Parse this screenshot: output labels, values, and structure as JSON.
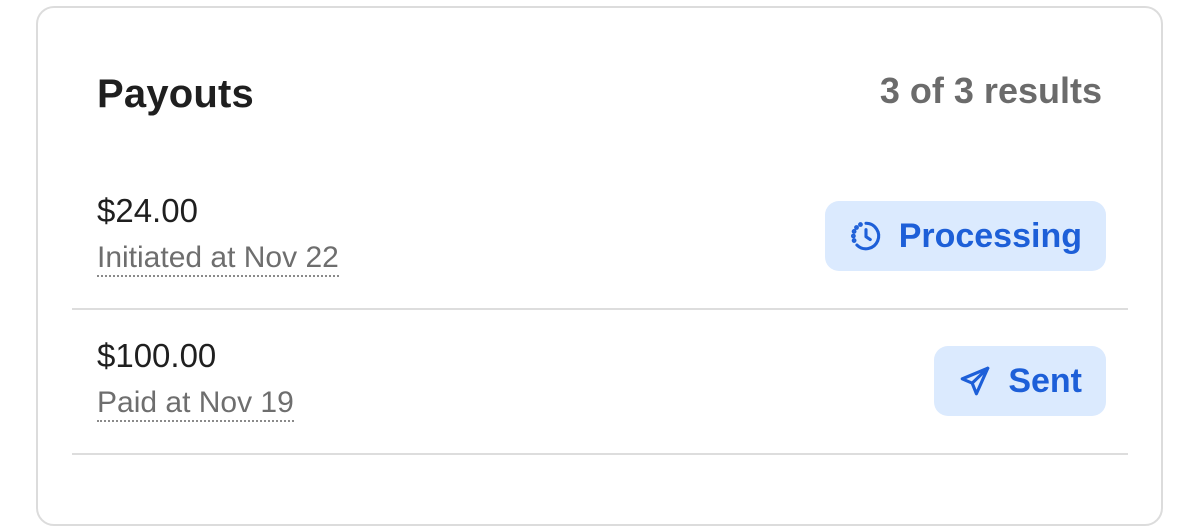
{
  "card": {
    "title": "Payouts",
    "results_count": "3 of 3 results"
  },
  "payouts": [
    {
      "amount": "$24.00",
      "detail": "Initiated at Nov 22",
      "status": "Processing",
      "status_icon": "clock-icon"
    },
    {
      "amount": "$100.00",
      "detail": "Paid at Nov 19",
      "status": "Sent",
      "status_icon": "send-icon"
    }
  ],
  "colors": {
    "badge_bg": "#dbeafe",
    "badge_text": "#1d5fd8",
    "title": "#1f1f1f",
    "muted": "#6b6b6b"
  }
}
